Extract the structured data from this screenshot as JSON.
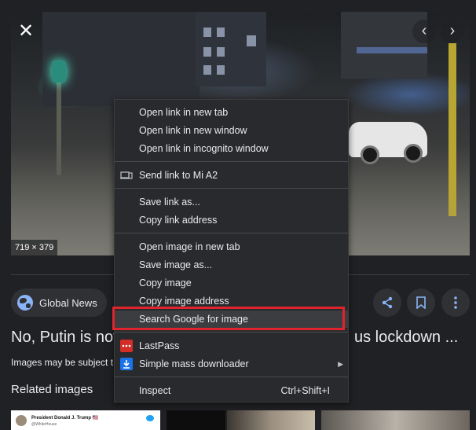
{
  "viewer": {
    "close_icon": "close-icon",
    "prev_icon": "chevron-left-icon",
    "next_icon": "chevron-right-icon",
    "dimensions": "719 × 379"
  },
  "source": {
    "label": "Global News",
    "icon": "globe-icon"
  },
  "actions": {
    "share_icon": "share-icon",
    "save_icon": "bookmark-icon",
    "more_icon": "more-vert-icon"
  },
  "result": {
    "title_start": "No, Putin is not",
    "title_end": "us lockdown ...",
    "notice": "Images may be subject t"
  },
  "related": {
    "heading": "Related images",
    "thumb_caption": "President Donald J. Trump 🇺🇸",
    "thumb_handle": "@WhiteHouse",
    "thumb_tag": "Verified"
  },
  "context_menu": {
    "open_new_tab": "Open link in new tab",
    "open_new_window": "Open link in new window",
    "open_incognito": "Open link in incognito window",
    "send_to_device": "Send link to Mi A2",
    "save_link_as": "Save link as...",
    "copy_link_address": "Copy link address",
    "open_image_new_tab": "Open image in new tab",
    "save_image_as": "Save image as...",
    "copy_image": "Copy image",
    "copy_image_address": "Copy image address",
    "search_google_for_image": "Search Google for image",
    "lastpass": "LastPass",
    "simple_mass_downloader": "Simple mass downloader",
    "inspect": "Inspect",
    "inspect_shortcut": "Ctrl+Shift+I"
  },
  "colors": {
    "background": "#202124",
    "menu": "#292a2d",
    "accent": "#8ab4f8",
    "highlight": "#e0242b"
  }
}
